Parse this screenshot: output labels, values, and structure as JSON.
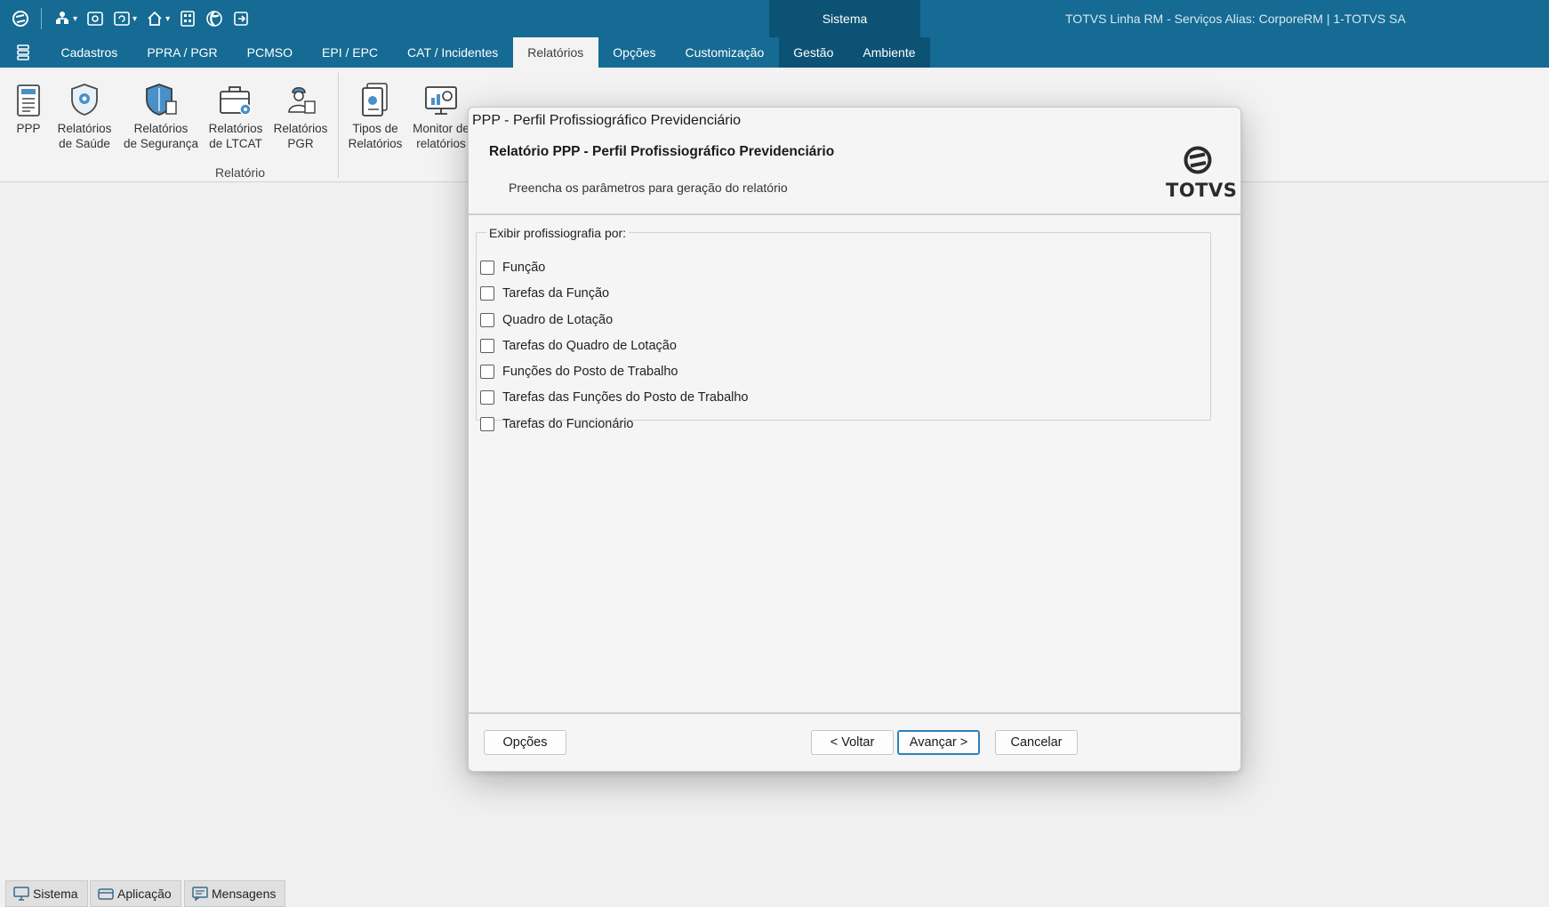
{
  "titlebar": {
    "context_label": "Sistema",
    "app_info": "TOTVS Linha RM - Serviços  Alias: CorporeRM | 1-TOTVS SA"
  },
  "menu": {
    "tabs": [
      {
        "label": "Cadastros"
      },
      {
        "label": "PPRA / PGR"
      },
      {
        "label": "PCMSO"
      },
      {
        "label": "EPI / EPC"
      },
      {
        "label": "CAT / Incidentes"
      },
      {
        "label": "Relatórios",
        "active": true
      },
      {
        "label": "Opções"
      },
      {
        "label": "Customização"
      },
      {
        "label": "Gestão"
      },
      {
        "label": "Ambiente"
      }
    ]
  },
  "ribbon": {
    "buttons": [
      {
        "line1": "PPP",
        "line2": ""
      },
      {
        "line1": "Relatórios",
        "line2": "de Saúde"
      },
      {
        "line1": "Relatórios",
        "line2": "de Segurança"
      },
      {
        "line1": "Relatórios",
        "line2": "de LTCAT"
      },
      {
        "line1": "Relatórios",
        "line2": "PGR"
      },
      {
        "line1": "Tipos de",
        "line2": "Relatórios"
      },
      {
        "line1": "Monitor de",
        "line2": "relatórios"
      }
    ],
    "group_label": "Relatório"
  },
  "dialog": {
    "window_title": "PPP - Perfil Profissiográfico Previdenciário",
    "header_title": "Relatório PPP - Perfil Profissiográfico Previdenciário",
    "header_subtitle": "Preencha os parâmetros para geração do relatório",
    "logo_text": "TOTVS",
    "group_legend": "Exibir profissiografia por:",
    "options": [
      {
        "label": "Função",
        "checked": false
      },
      {
        "label": "Tarefas da Função",
        "checked": false
      },
      {
        "label": "Quadro de Lotação",
        "checked": false
      },
      {
        "label": "Tarefas do Quadro de Lotação",
        "checked": false
      },
      {
        "label": "Funções do Posto de Trabalho",
        "checked": false
      },
      {
        "label": "Tarefas das Funções do Posto de Trabalho",
        "checked": false
      },
      {
        "label": "Tarefas do Funcionário",
        "checked": false
      }
    ],
    "buttons": {
      "options": "Opções",
      "back": "< Voltar",
      "next": "Avançar >",
      "cancel": "Cancelar"
    }
  },
  "statusbar": {
    "tabs": [
      {
        "label": "Sistema"
      },
      {
        "label": "Aplicação"
      },
      {
        "label": "Mensagens"
      }
    ]
  },
  "colors": {
    "titlebar": "#156b93",
    "context_tab": "#0b5275",
    "accent": "#2e7fb8"
  }
}
